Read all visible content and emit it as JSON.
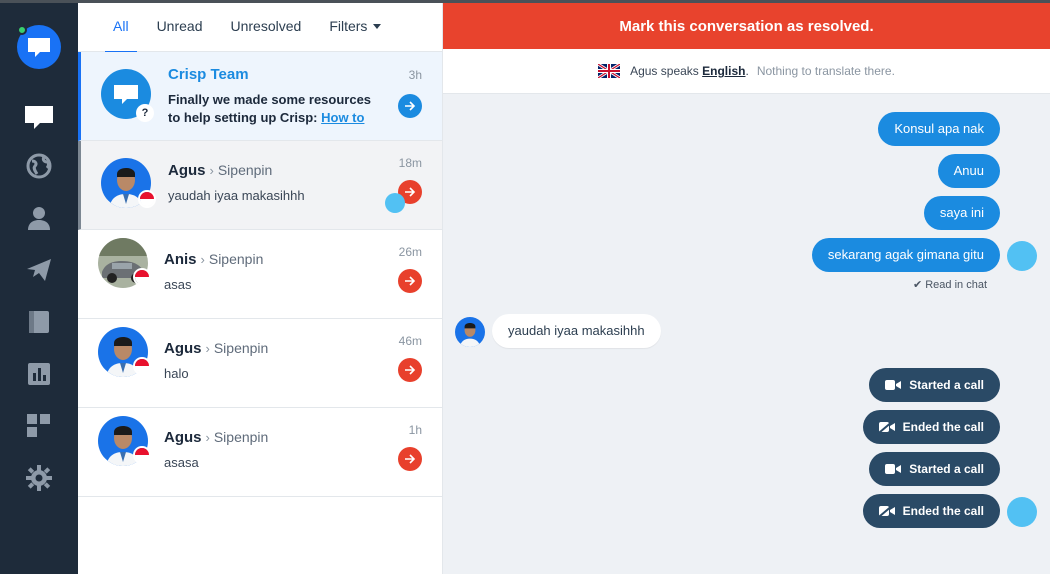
{
  "sidebar": {
    "items": [
      {
        "icon": "chat-icon"
      },
      {
        "icon": "globe-icon"
      },
      {
        "icon": "user-icon"
      },
      {
        "icon": "paper-plane-icon"
      },
      {
        "icon": "book-icon"
      },
      {
        "icon": "analytics-icon"
      },
      {
        "icon": "plugins-icon"
      },
      {
        "icon": "settings-icon"
      }
    ]
  },
  "tabs": {
    "all": "All",
    "unread": "Unread",
    "unresolved": "Unresolved",
    "filters": "Filters"
  },
  "conversations": [
    {
      "name": "Crisp Team",
      "message_line1": "Finally we made some resources",
      "message_line2": "to help setting up Crisp:",
      "link": "How to",
      "time": "3h"
    },
    {
      "name": "Agus",
      "website": "Sipenpin",
      "message": "yaudah iyaa makasihhh",
      "time": "18m"
    },
    {
      "name": "Anis",
      "website": "Sipenpin",
      "message": "asas",
      "time": "26m"
    },
    {
      "name": "Agus",
      "website": "Sipenpin",
      "message": "halo",
      "time": "46m"
    },
    {
      "name": "Agus",
      "website": "Sipenpin",
      "message": "asasa",
      "time": "1h"
    }
  ],
  "chat": {
    "resolve_banner": "Mark this conversation as resolved.",
    "translate_prefix": "Agus speaks",
    "translate_lang": "English",
    "translate_note": "Nothing to translate there.",
    "messages": {
      "m1": "Konsul apa nak",
      "m2": "Anuu",
      "m3": "saya ini",
      "m4": "sekarang agak gimana gitu",
      "read": "Read in chat",
      "user_msg": "yaudah iyaa makasihhh",
      "call_start_1": "Started a call",
      "call_end_1": "Ended the call",
      "call_start_2": "Started a call",
      "call_end_2": "Ended the call"
    }
  },
  "colors": {
    "sidebar": "#1e2b3a",
    "accent": "#1972f5",
    "resolve": "#e8432d",
    "operator_bubble": "#1b8be0",
    "call_bubble": "#2a4a66"
  }
}
